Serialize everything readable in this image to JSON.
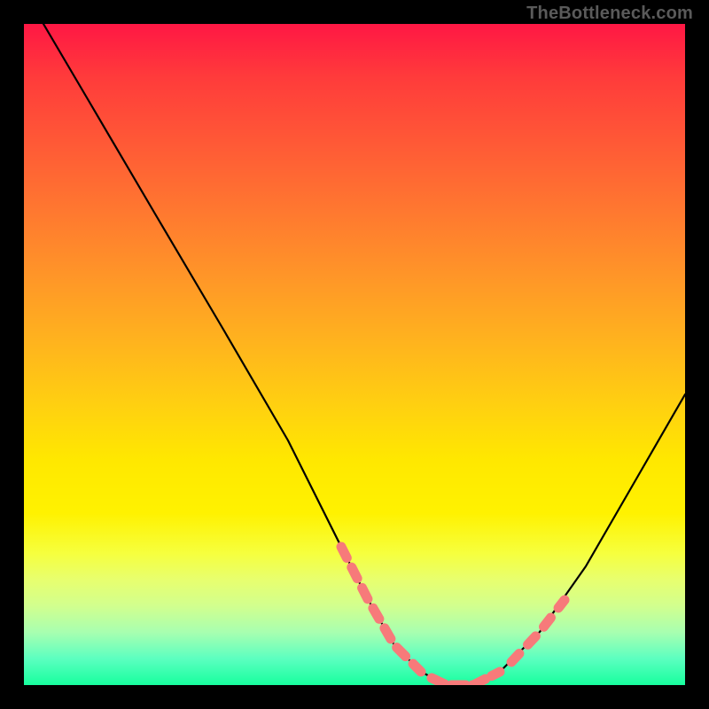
{
  "watermark": "TheBottleneck.com",
  "chart_data": {
    "type": "line",
    "title": "",
    "xlabel": "",
    "ylabel": "",
    "xlim": [
      0,
      100
    ],
    "ylim": [
      0,
      100
    ],
    "curve": {
      "name": "bottleneck-curve",
      "x": [
        3,
        10,
        20,
        30,
        40,
        48,
        52,
        56,
        60,
        64,
        68,
        72,
        78,
        85,
        92,
        100
      ],
      "y": [
        100,
        88,
        71,
        54,
        37,
        21,
        13,
        6,
        2,
        0,
        0,
        2,
        8,
        18,
        30,
        44
      ]
    },
    "highlight_segments": [
      {
        "x": [
          48,
          60
        ],
        "y_est": [
          21,
          2
        ],
        "note": "scattered dashed pink left flank"
      },
      {
        "x": [
          62,
          72
        ],
        "y_est": [
          0,
          2
        ],
        "note": "dense pink floor cluster"
      },
      {
        "x": [
          74,
          82
        ],
        "y_est": [
          4,
          13
        ],
        "note": "scattered dashed pink right flank"
      }
    ],
    "colors": {
      "curve": "#000000",
      "highlight": "#f77a7a",
      "gradient_top": "#ff1744",
      "gradient_bottom": "#17ff9e"
    }
  }
}
